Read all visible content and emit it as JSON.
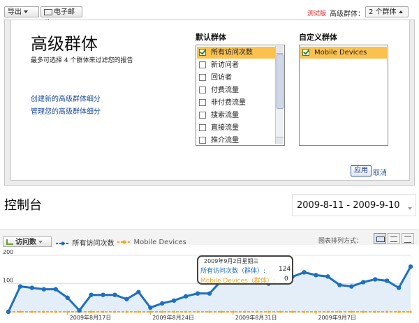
{
  "toolbar": {
    "export_label": "导出",
    "email_label": "电子邮件",
    "beta_label": "测试版",
    "segment_label": "高级群体：",
    "segment_count": "2 个群体"
  },
  "segment_panel": {
    "title": "高级群体",
    "subtitle": "最多可选择 4 个群体来过滤您的报告",
    "create_link": "创建新的高级群体细分",
    "manage_link": "管理您的高级群体细分",
    "default_header": "默认群体",
    "custom_header": "自定义群体",
    "default_items": [
      {
        "label": "所有访问次数",
        "checked": true
      },
      {
        "label": "新访问者",
        "checked": false
      },
      {
        "label": "回访者",
        "checked": false
      },
      {
        "label": "付费流量",
        "checked": false
      },
      {
        "label": "非付费流量",
        "checked": false
      },
      {
        "label": "搜索流量",
        "checked": false
      },
      {
        "label": "直接流量",
        "checked": false
      },
      {
        "label": "推介流量",
        "checked": false
      }
    ],
    "custom_items": [
      {
        "label": "Mobile Devices",
        "checked": true
      }
    ],
    "apply_label": "应用",
    "cancel_label": "取消"
  },
  "dashboard": {
    "title": "控制台",
    "date_range": "2009-8-11 - 2009-9-10"
  },
  "chart_controls": {
    "metric_label": "访问数",
    "legend": [
      {
        "name": "所有访问次数",
        "color": "#1e6fc0"
      },
      {
        "name": "Mobile Devices",
        "color": "#f5a623"
      }
    ],
    "view_label": "图表排列方式："
  },
  "tooltip": {
    "date": "2009年9月2日星期三",
    "line1_label": "所有访问次数（群体）:",
    "line1_value": "124",
    "line2_label": "Mobile Devices（群体）:",
    "line2_value": "0"
  },
  "chart_data": {
    "type": "line",
    "x_ticks": [
      "2009年8月17日",
      "2009年8月24日",
      "2009年8月31日",
      "2009年9月7日"
    ],
    "y_ticks": [
      200,
      100
    ],
    "ylim": [
      0,
      200
    ],
    "series": [
      {
        "name": "所有访问次数",
        "color": "#1e6fc0",
        "values": [
          0,
          90,
          85,
          80,
          80,
          50,
          5,
          60,
          60,
          60,
          45,
          70,
          15,
          30,
          40,
          55,
          65,
          65,
          110,
          105,
          115,
          120,
          100,
          105,
          124,
          140,
          130,
          125,
          95,
          90,
          105,
          115,
          110,
          85,
          160
        ]
      },
      {
        "name": "Mobile Devices",
        "color": "#f5a623",
        "values": [
          0,
          0,
          0,
          0,
          0,
          0,
          0,
          0,
          0,
          0,
          0,
          0,
          0,
          0,
          0,
          0,
          0,
          0,
          0,
          0,
          0,
          0,
          0,
          0,
          0,
          0,
          0,
          0,
          0,
          0,
          0,
          0,
          0,
          0,
          0
        ]
      }
    ]
  }
}
